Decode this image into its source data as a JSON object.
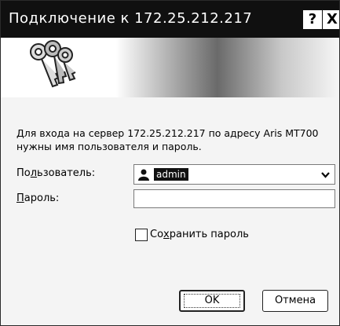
{
  "window": {
    "title": "Подключение к 172.25.212.217",
    "help_label": "?",
    "close_label": "X"
  },
  "banner": {
    "icon": "keys-icon"
  },
  "message": "Для входа на сервер 172.25.212.217 по адресу Aris MT700 нужны имя пользователя и пароль.",
  "form": {
    "user_label_pre": "По",
    "user_label_u": "л",
    "user_label_post": "ьзователь:",
    "user_value": "admin",
    "user_icon": "user-icon",
    "password_label_u": "П",
    "password_label_post": "ароль:",
    "password_value": "",
    "remember_pre": "Со",
    "remember_u": "х",
    "remember_post": "ранить пароль",
    "remember_checked": false
  },
  "buttons": {
    "ok": "OK",
    "cancel": "Отмена"
  },
  "colors": {
    "titlebar": "#101010",
    "selection": "#101010",
    "dialog_bg": "#f4f4f4"
  }
}
